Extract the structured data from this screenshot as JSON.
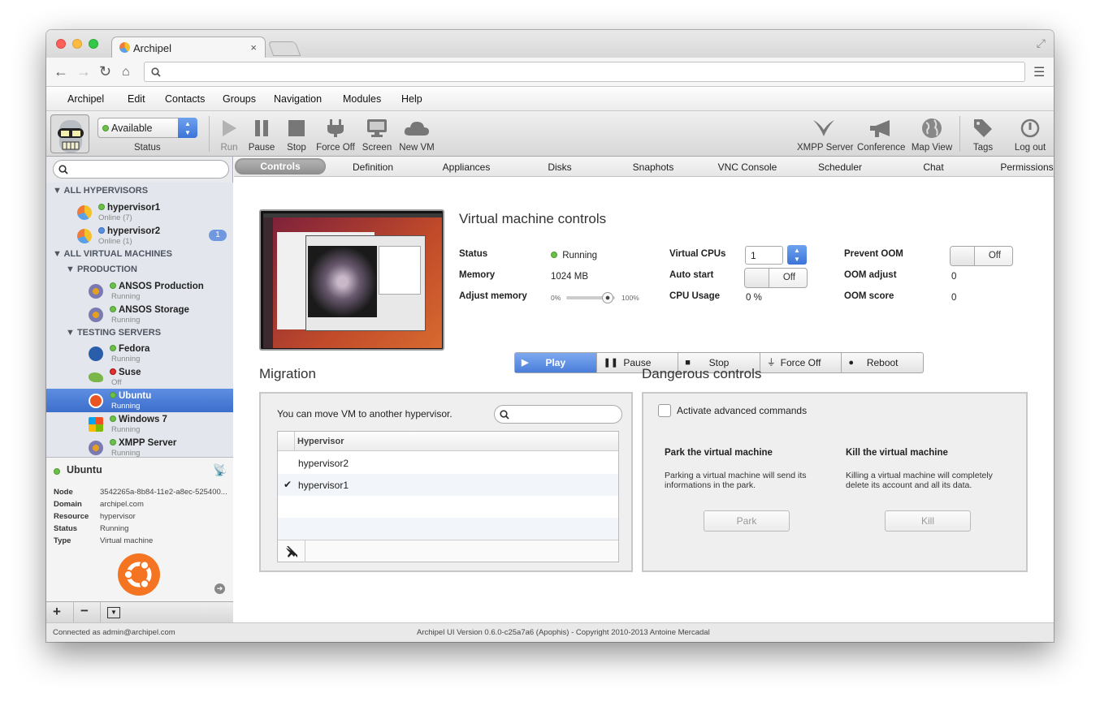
{
  "browser": {
    "tab_title": "Archipel",
    "tab_close": "×"
  },
  "menu": [
    "Archipel",
    "Edit",
    "Contacts",
    "Groups",
    "Navigation",
    "Modules",
    "Help"
  ],
  "toolbar": {
    "status_value": "Available",
    "status_label": "Status",
    "vm_actions": [
      "Run",
      "Pause",
      "Stop",
      "Force Off",
      "Screen",
      "New VM"
    ],
    "right_actions": [
      "XMPP Server",
      "Conference",
      "Map View",
      "Tags",
      "Log out"
    ]
  },
  "sidebar": {
    "groups": {
      "hypervisors": "ALL HYPERVISORS",
      "vms": "ALL VIRTUAL MACHINES",
      "production": "PRODUCTION",
      "testing": "TESTING SERVERS"
    },
    "hypervisors": [
      {
        "name": "hypervisor1",
        "status": "Online (7)"
      },
      {
        "name": "hypervisor2",
        "status": "Online (1)",
        "badge": "1"
      }
    ],
    "production": [
      {
        "name": "ANSOS Production",
        "status": "Running"
      },
      {
        "name": "ANSOS Storage",
        "status": "Running"
      }
    ],
    "testing": [
      {
        "name": "Fedora",
        "status": "Running"
      },
      {
        "name": "Suse",
        "status": "Off"
      },
      {
        "name": "Ubuntu",
        "status": "Running"
      },
      {
        "name": "Windows 7",
        "status": "Running"
      },
      {
        "name": "XMPP Server",
        "status": "Running"
      }
    ],
    "selected": {
      "title": "Ubuntu",
      "fields": [
        {
          "k": "Node",
          "v": "3542265a-8b84-11e2-a8ec-525400..."
        },
        {
          "k": "Domain",
          "v": "archipel.com"
        },
        {
          "k": "Resource",
          "v": "hypervisor"
        },
        {
          "k": "Status",
          "v": "Running"
        },
        {
          "k": "Type",
          "v": "Virtual machine"
        }
      ]
    }
  },
  "tabs": [
    "Controls",
    "Definition",
    "Appliances",
    "Disks",
    "Snaphots",
    "VNC Console",
    "Scheduler",
    "Chat",
    "Permissions"
  ],
  "controls": {
    "title": "Virtual machine controls",
    "status_label": "Status",
    "status_value": "Running",
    "memory_label": "Memory",
    "memory_value": "1024 MB",
    "adjust_label": "Adjust memory",
    "adjust_min": "0%",
    "adjust_max": "100%",
    "adjust_level": 0.85,
    "vcpu_label": "Virtual CPUs",
    "vcpu_value": "1",
    "autostart_label": "Auto start",
    "autostart_value": "Off",
    "cpu_label": "CPU Usage",
    "cpu_value": "0 %",
    "oom_label": "Prevent OOM",
    "oom_value": "Off",
    "oomadj_label": "OOM adjust",
    "oomadj_value": "0",
    "oomscore_label": "OOM score",
    "oomscore_value": "0",
    "buttons": [
      "Play",
      "Pause",
      "Stop",
      "Force Off",
      "Reboot"
    ]
  },
  "migration": {
    "title": "Migration",
    "text": "You can move VM to another hypervisor.",
    "column": "Hypervisor",
    "rows": [
      "hypervisor2",
      "hypervisor1"
    ],
    "checked": "✔"
  },
  "danger": {
    "title": "Dangerous controls",
    "checkbox": "Activate advanced commands",
    "park_title": "Park the virtual machine",
    "park_text": "Parking a virtual machine will send its informations in the park.",
    "park_btn": "Park",
    "kill_title": "Kill the virtual machine",
    "kill_text": "Killing a virtual machine will completely delete its account and all its data.",
    "kill_btn": "Kill"
  },
  "footer": {
    "left": "Connected as admin@archipel.com",
    "center": "Archipel UI Version 0.6.0-c25a7a6 (Apophis) - Copyright 2010-2013 Antoine Mercadal"
  }
}
